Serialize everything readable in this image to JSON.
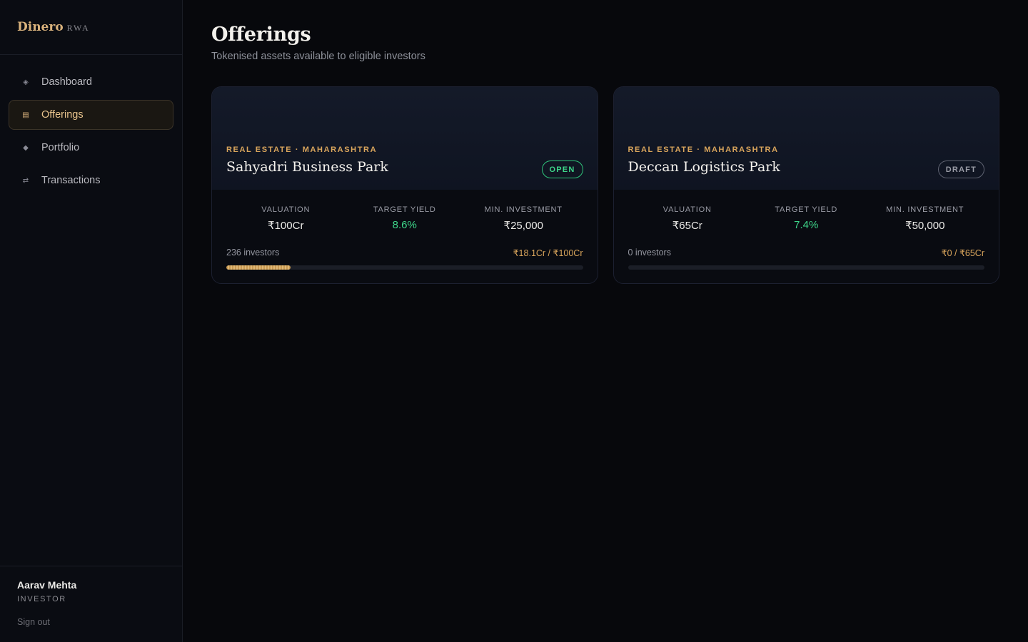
{
  "brand": {
    "name": "Dinero",
    "sub": "RWA"
  },
  "nav": {
    "items": [
      {
        "label": "Dashboard",
        "icon": "diamond-outline-icon",
        "glyph": "◈"
      },
      {
        "label": "Offerings",
        "icon": "list-icon",
        "glyph": "▤",
        "active": true
      },
      {
        "label": "Portfolio",
        "icon": "diamond-icon",
        "glyph": "◆"
      },
      {
        "label": "Transactions",
        "icon": "swap-icon",
        "glyph": "⇄"
      }
    ]
  },
  "user": {
    "name": "Aarav Mehta",
    "role": "INVESTOR",
    "signout": "Sign out"
  },
  "page": {
    "title": "Offerings",
    "subtitle": "Tokenised assets available to eligible investors"
  },
  "offerings": [
    {
      "category": "REAL ESTATE · MAHARASHTRA",
      "title": "Sahyadri Business Park",
      "status": "OPEN",
      "stats": [
        {
          "label": "VALUATION",
          "value": "₹100Cr"
        },
        {
          "label": "TARGET YIELD",
          "value": "8.6%"
        },
        {
          "label": "MIN. INVESTMENT",
          "value": "₹25,000"
        }
      ],
      "investors": "236 investors",
      "raised": "₹18.1Cr / ₹100Cr",
      "progress": 0.181
    },
    {
      "category": "REAL ESTATE · MAHARASHTRA",
      "title": "Deccan Logistics Park",
      "status": "DRAFT",
      "stats": [
        {
          "label": "VALUATION",
          "value": "₹65Cr"
        },
        {
          "label": "TARGET YIELD",
          "value": "7.4%"
        },
        {
          "label": "MIN. INVESTMENT",
          "value": "₹50,000"
        }
      ],
      "investors": "0 investors",
      "raised": "₹0 / ₹65Cr",
      "progress": 0
    }
  ],
  "colors": {
    "accent": "#d9a55c",
    "open": "#3ed68a",
    "background": "#07080c"
  }
}
